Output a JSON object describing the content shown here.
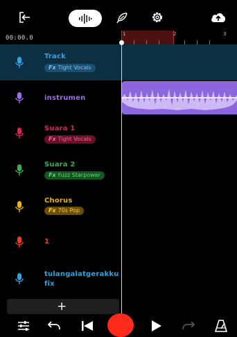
{
  "app": {
    "time_display": "00:00.0"
  },
  "ruler": {
    "bars": [
      "1",
      "2",
      "3"
    ]
  },
  "tracks": [
    {
      "name": "Track",
      "fx": "Tight Vocals",
      "color": "#2ba3ea",
      "fx_bg": "#1c4e70",
      "fx_fg": "#79c3f0"
    },
    {
      "name": "instrumen",
      "fx": "",
      "color": "#9b6cf2"
    },
    {
      "name": "Suara 1",
      "fx": "Tight Vocals",
      "color": "#e61e58",
      "fx_bg": "#6a0f2a",
      "fx_fg": "#f06a90"
    },
    {
      "name": "Suara 2",
      "fx": "Fuzz Starpower",
      "color": "#2fb34a",
      "fx_bg": "#155520",
      "fx_fg": "#5fd57a"
    },
    {
      "name": "Chorus",
      "fx": "70s Pop",
      "color": "#f0b400",
      "fx_bg": "#6b4f00",
      "fx_fg": "#f5c944"
    },
    {
      "name": "1",
      "fx": "",
      "color": "#f03c14"
    },
    {
      "name": "tulangalatgerakkufix",
      "fx": "",
      "color": "#2ba3ea"
    }
  ],
  "fx_prefix": "Fx",
  "add_track_label": "+",
  "icons": {
    "exit": "exit-icon",
    "waveform": "waveform-icon",
    "feather": "feather-icon",
    "settings": "gear-icon",
    "cloud": "cloud-upload-icon",
    "mixer": "sliders-icon",
    "undo": "undo-icon",
    "rewind": "skip-back-icon",
    "record": "record-icon",
    "play": "play-icon",
    "redo": "redo-icon",
    "metronome": "metronome-icon"
  },
  "colors": {
    "record": "#ff2a1a",
    "selected_track": "#0d2f42",
    "clip": "#8b66dd"
  }
}
